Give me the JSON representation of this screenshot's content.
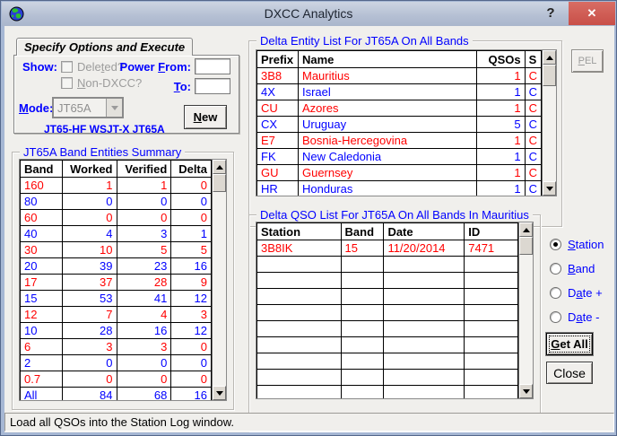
{
  "window": {
    "title": "DXCC Analytics",
    "help_label": "?",
    "close_label": "✕"
  },
  "tabs": {
    "active": "Specify Options and Execute",
    "inactive": "N/A"
  },
  "options": {
    "show_label": "Show:",
    "deleted": {
      "pre": "Dele",
      "accel": "t",
      "post": "ed?"
    },
    "non_dxcc": {
      "pre": "",
      "accel": "N",
      "post": "on-DXCC?"
    },
    "power_from": {
      "pre": "Power ",
      "accel": "F",
      "post": "rom:"
    },
    "to": {
      "pre": "",
      "accel": "T",
      "post": "o:"
    },
    "mode": {
      "pre": "",
      "accel": "M",
      "post": "ode:"
    },
    "power_from_value": "",
    "to_value": "",
    "mode_value": "JT65A",
    "mode_note": "JT65-HF WSJT-X JT65A",
    "new_btn": {
      "pre": "",
      "accel": "N",
      "post": "ew"
    }
  },
  "band_summary": {
    "title": "JT65A Band Entities Summary",
    "headers": [
      "Band",
      "Worked",
      "Verified",
      "Delta"
    ],
    "rows": [
      {
        "band": "160",
        "worked": "1",
        "verified": "1",
        "delta": "0",
        "color": "red"
      },
      {
        "band": "80",
        "worked": "0",
        "verified": "0",
        "delta": "0",
        "color": "blue"
      },
      {
        "band": "60",
        "worked": "0",
        "verified": "0",
        "delta": "0",
        "color": "red"
      },
      {
        "band": "40",
        "worked": "4",
        "verified": "3",
        "delta": "1",
        "color": "blue"
      },
      {
        "band": "30",
        "worked": "10",
        "verified": "5",
        "delta": "5",
        "color": "red"
      },
      {
        "band": "20",
        "worked": "39",
        "verified": "23",
        "delta": "16",
        "color": "blue"
      },
      {
        "band": "17",
        "worked": "37",
        "verified": "28",
        "delta": "9",
        "color": "red"
      },
      {
        "band": "15",
        "worked": "53",
        "verified": "41",
        "delta": "12",
        "color": "blue"
      },
      {
        "band": "12",
        "worked": "7",
        "verified": "4",
        "delta": "3",
        "color": "red"
      },
      {
        "band": "10",
        "worked": "28",
        "verified": "16",
        "delta": "12",
        "color": "blue"
      },
      {
        "band": "6",
        "worked": "3",
        "verified": "3",
        "delta": "0",
        "color": "red"
      },
      {
        "band": "2",
        "worked": "0",
        "verified": "0",
        "delta": "0",
        "color": "blue"
      },
      {
        "band": "0.7",
        "worked": "0",
        "verified": "0",
        "delta": "0",
        "color": "red"
      },
      {
        "band": "All",
        "worked": "84",
        "verified": "68",
        "delta": "16",
        "color": "blue"
      },
      {
        "band": "",
        "worked": "",
        "verified": "",
        "delta": "",
        "color": ""
      }
    ]
  },
  "entity_list": {
    "title": "Delta Entity List For JT65A On All Bands",
    "headers": [
      "Prefix",
      "Name",
      "QSOs",
      "S"
    ],
    "rows": [
      {
        "prefix": "3B8",
        "name": "Mauritius",
        "qsos": "1",
        "s": "C",
        "color": "red"
      },
      {
        "prefix": "4X",
        "name": "Israel",
        "qsos": "1",
        "s": "C",
        "color": "blue"
      },
      {
        "prefix": "CU",
        "name": "Azores",
        "qsos": "1",
        "s": "C",
        "color": "red"
      },
      {
        "prefix": "CX",
        "name": "Uruguay",
        "qsos": "5",
        "s": "C",
        "color": "blue"
      },
      {
        "prefix": "E7",
        "name": "Bosnia-Hercegovina",
        "qsos": "1",
        "s": "C",
        "color": "red"
      },
      {
        "prefix": "FK",
        "name": "New Caledonia",
        "qsos": "1",
        "s": "C",
        "color": "blue"
      },
      {
        "prefix": "GU",
        "name": "Guernsey",
        "qsos": "1",
        "s": "C",
        "color": "red"
      },
      {
        "prefix": "HR",
        "name": "Honduras",
        "qsos": "1",
        "s": "C",
        "color": "blue"
      }
    ]
  },
  "pel_btn": {
    "pre": "",
    "accel": "P",
    "post": "EL"
  },
  "qso_list": {
    "title": "Delta QSO List For JT65A On All Bands In Mauritius",
    "headers": [
      "Station",
      "Band",
      "Date",
      "ID"
    ],
    "rows": [
      {
        "station": "3B8IK",
        "band": "15",
        "date": "11/20/2014",
        "id": "7471",
        "color": "red"
      },
      {
        "station": "",
        "band": "",
        "date": "",
        "id": "",
        "color": ""
      },
      {
        "station": "",
        "band": "",
        "date": "",
        "id": "",
        "color": ""
      },
      {
        "station": "",
        "band": "",
        "date": "",
        "id": "",
        "color": ""
      },
      {
        "station": "",
        "band": "",
        "date": "",
        "id": "",
        "color": ""
      },
      {
        "station": "",
        "band": "",
        "date": "",
        "id": "",
        "color": ""
      },
      {
        "station": "",
        "band": "",
        "date": "",
        "id": "",
        "color": ""
      },
      {
        "station": "",
        "band": "",
        "date": "",
        "id": "",
        "color": ""
      },
      {
        "station": "",
        "band": "",
        "date": "",
        "id": "",
        "color": ""
      },
      {
        "station": "",
        "band": "",
        "date": "",
        "id": "",
        "color": ""
      }
    ]
  },
  "sort_options": {
    "station": {
      "pre": "",
      "accel": "S",
      "post": "tation",
      "selected": true
    },
    "band": {
      "pre": "",
      "accel": "B",
      "post": "and"
    },
    "date_plus": {
      "pre": "D",
      "accel": "a",
      "post": "te +"
    },
    "date_minus": {
      "pre": "D",
      "accel": "a",
      "post": "te -"
    }
  },
  "buttons": {
    "get_all": {
      "pre": "",
      "accel": "G",
      "post": "et All"
    },
    "close_label": "Close"
  },
  "status_bar": "Load all QSOs into the Station Log window.",
  "colors": {
    "row_red": "#ff0000",
    "row_blue": "#0000ff",
    "label_blue": "#0000ff",
    "close_red": "#cd5650",
    "titlebar": "#b4bfd3",
    "window_border": "#a6b7d4"
  }
}
